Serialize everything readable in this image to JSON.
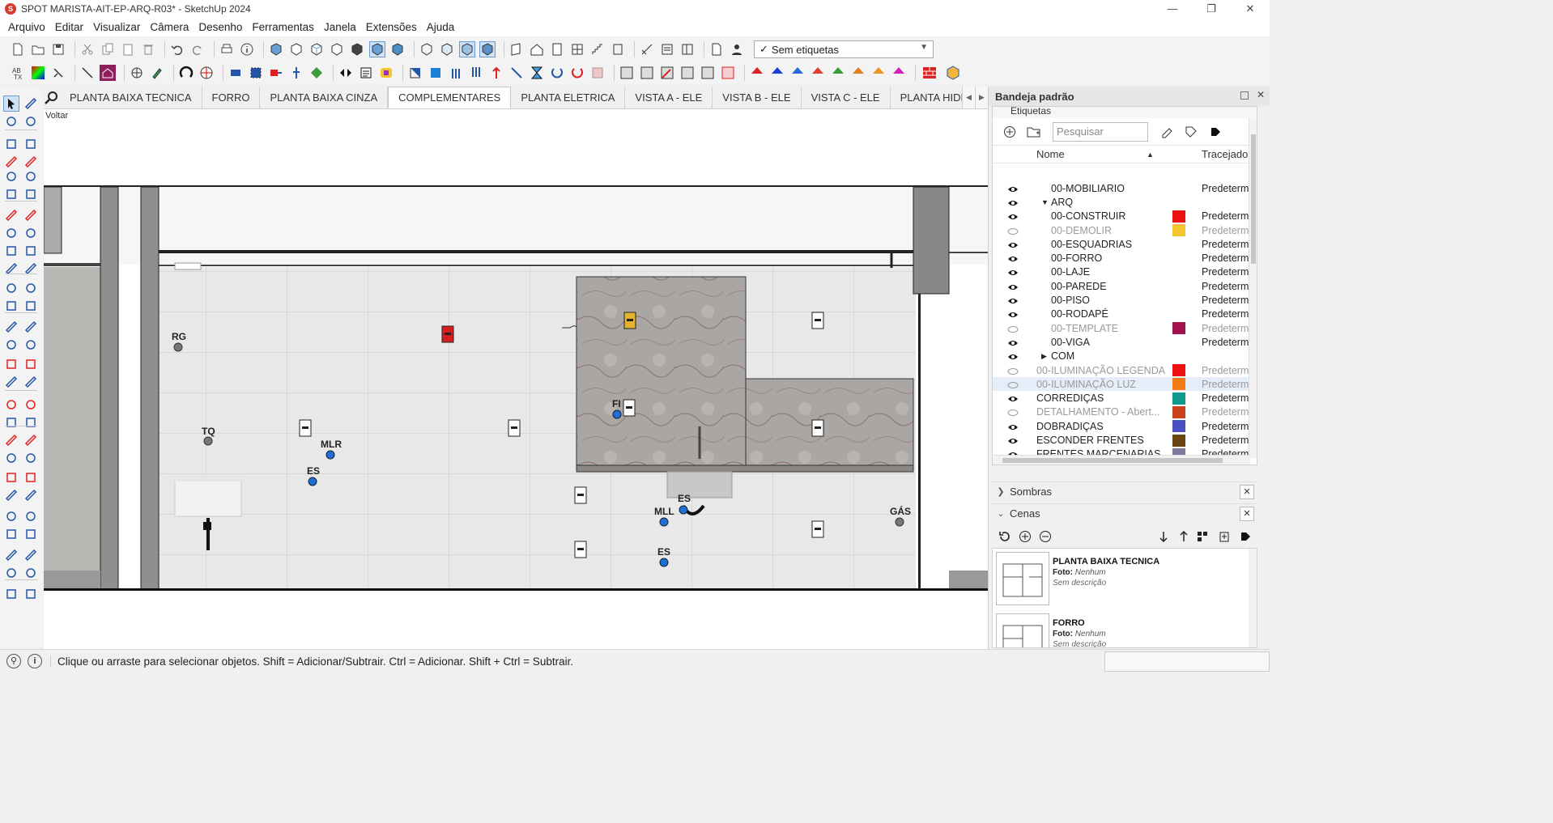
{
  "window": {
    "title": "SPOT MARISTA-AIT-EP-ARQ-R03* - SketchUp 2024",
    "app_icon": "sketchup-icon",
    "minimize": "—",
    "maximize": "❐",
    "close": "✕"
  },
  "menu": [
    "Arquivo",
    "Editar",
    "Visualizar",
    "Câmera",
    "Desenho",
    "Ferramentas",
    "Janela",
    "Extensões",
    "Ajuda"
  ],
  "toolbar": {
    "tag_select_value": "Sem etiquetas",
    "tag_select_check": "✓"
  },
  "scene_tabs": {
    "items": [
      "PLANTA BAIXA TECNICA",
      "FORRO",
      "PLANTA BAIXA CINZA",
      "COMPLEMENTARES",
      "PLANTA ELETRICA",
      "VISTA A - ELE",
      "VISTA B - ELE",
      "VISTA C - ELE",
      "PLANTA HIDRAULICA"
    ],
    "active": "COMPLEMENTARES"
  },
  "viewport": {
    "back_label": "Voltar",
    "point_labels": {
      "rg": "RG",
      "tq": "TQ",
      "mlr": "MLR",
      "es1": "ES",
      "fi": "FI",
      "es2": "ES",
      "mll": "MLL",
      "es3": "ES",
      "gas": "GÁS"
    }
  },
  "tray": {
    "title": "Bandeja padrão",
    "tags": {
      "section_title": "Etiquetas",
      "search_placeholder": "Pesquisar",
      "col_name": "Nome",
      "col_dash": "Tracejado",
      "rows": [
        {
          "name": "00-MOBILIARIO",
          "indent": 2,
          "visible": true,
          "color": "",
          "dash": "Predeterminado"
        },
        {
          "name": "ARQ",
          "indent": 1,
          "visible": true,
          "color": "",
          "dash": "",
          "expand": "▼"
        },
        {
          "name": "00-CONSTRUIR",
          "indent": 2,
          "visible": true,
          "color": "#ee1111",
          "dash": "Predeterminado"
        },
        {
          "name": "00-DEMOLIR",
          "indent": 2,
          "visible": false,
          "color": "#f4c431",
          "dash": "Predeterminado"
        },
        {
          "name": "00-ESQUADRIAS",
          "indent": 2,
          "visible": true,
          "color": "",
          "dash": "Predeterminado"
        },
        {
          "name": "00-FORRO",
          "indent": 2,
          "visible": true,
          "color": "",
          "dash": "Predeterminado"
        },
        {
          "name": "00-LAJE",
          "indent": 2,
          "visible": true,
          "color": "",
          "dash": "Predeterminado"
        },
        {
          "name": "00-PAREDE",
          "indent": 2,
          "visible": true,
          "color": "",
          "dash": "Predeterminado"
        },
        {
          "name": "00-PISO",
          "indent": 2,
          "visible": true,
          "color": "",
          "dash": "Predeterminado"
        },
        {
          "name": "00-RODAPÉ",
          "indent": 2,
          "visible": true,
          "color": "",
          "dash": "Predeterminado"
        },
        {
          "name": "00-TEMPLATE",
          "indent": 2,
          "visible": false,
          "color": "#a0134f",
          "dash": "Predeterminado"
        },
        {
          "name": "00-VIGA",
          "indent": 2,
          "visible": true,
          "color": "",
          "dash": "Predeterminado"
        },
        {
          "name": "COM",
          "indent": 1,
          "visible": true,
          "color": "",
          "dash": "",
          "expand": "▶"
        },
        {
          "name": "00-ILUMINAÇÃO LEGENDA",
          "indent": 0,
          "visible": false,
          "color": "#ee1111",
          "dash": "Predeterminado"
        },
        {
          "name": "00-ILUMINAÇÃO LUZ",
          "indent": 0,
          "visible": false,
          "color": "#f57a1a",
          "dash": "Predeterminado",
          "selected": true
        },
        {
          "name": "CORREDIÇAS",
          "indent": 0,
          "visible": true,
          "color": "#119b8c",
          "dash": "Predeterminado"
        },
        {
          "name": "DETALHAMENTO - Abert...",
          "indent": 0,
          "visible": false,
          "color": "#c94418",
          "dash": "Predeterminado"
        },
        {
          "name": "DOBRADIÇAS",
          "indent": 0,
          "visible": true,
          "color": "#4a4fc1",
          "dash": "Predeterminado"
        },
        {
          "name": "ESCONDER FRENTES",
          "indent": 0,
          "visible": true,
          "color": "#6a4512",
          "dash": "Predeterminado"
        },
        {
          "name": "FRENTES MARCENARIAS",
          "indent": 0,
          "visible": true,
          "color": "#7c7a9a",
          "dash": "Predeterminado"
        }
      ]
    },
    "shadows": {
      "title": "Sombras"
    },
    "scenes": {
      "title": "Cenas",
      "items": [
        {
          "name": "PLANTA BAIXA TECNICA",
          "foto_label": "Foto:",
          "foto_value": "Nenhum",
          "desc": "Sem descrição"
        },
        {
          "name": "FORRO",
          "foto_label": "Foto:",
          "foto_value": "Nenhum",
          "desc": "Sem descrição"
        }
      ]
    }
  },
  "status": {
    "message": "Clique ou arraste para selecionar objetos. Shift = Adicionar/Subtrair. Ctrl = Adicionar. Shift + Ctrl = Subtrair."
  }
}
